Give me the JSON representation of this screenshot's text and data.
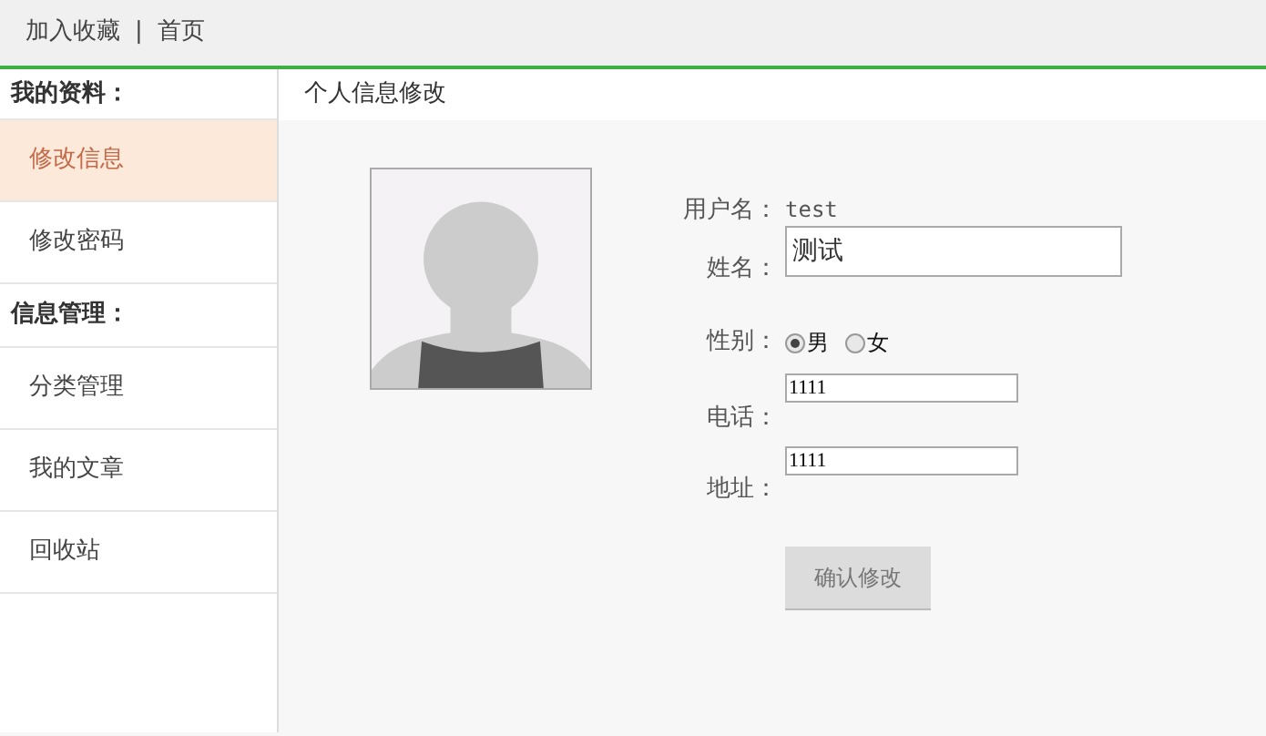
{
  "top_links": [
    "加入收藏",
    "首页"
  ],
  "top_separator": "|",
  "sidebar": {
    "sections": [
      {
        "title": "我的资料：",
        "items": [
          {
            "label": "修改信息",
            "selected": true
          },
          {
            "label": "修改密码",
            "selected": false
          }
        ]
      },
      {
        "title": "信息管理：",
        "items": [
          {
            "label": "分类管理",
            "selected": false
          },
          {
            "label": "我的文章",
            "selected": false
          },
          {
            "label": "回收站",
            "selected": false
          }
        ]
      }
    ]
  },
  "main": {
    "title": "个人信息修改",
    "form": {
      "username_label": "用户名：",
      "username": "test",
      "name_label": "姓名：",
      "name_value": "测试",
      "gender_label": "性别：",
      "genders": [
        {
          "label": "男",
          "selected": true
        },
        {
          "label": "女",
          "selected": false
        }
      ],
      "phone_label": "电话：",
      "phone_value": "1111",
      "address_label": "地址：",
      "address_value": "1111",
      "submit": "确认修改",
      "submit_disabled": true
    }
  }
}
